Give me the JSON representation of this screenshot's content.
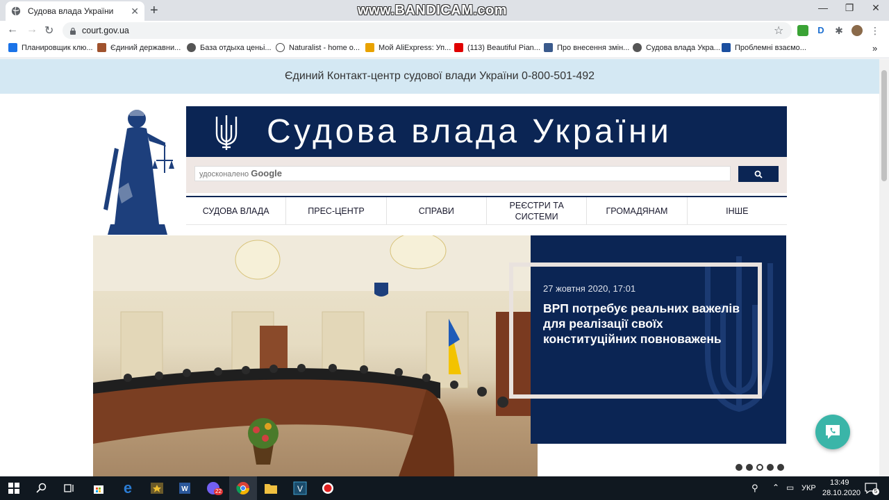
{
  "browser": {
    "tab_title": "Судова влада України",
    "new_tab": "+",
    "close_tab": "✕",
    "url": "court.gov.ua",
    "watermark": "www.BANDICAM.com",
    "window_controls": [
      "—",
      "❐",
      "✕"
    ],
    "bookmarks": [
      {
        "label": "Планировщик клю...",
        "color": "#1a73e8"
      },
      {
        "label": "Єдиний державни...",
        "color": "#a0522d"
      },
      {
        "label": "База отдыха ценьі...",
        "color": "#555555"
      },
      {
        "label": "Naturalist - home o...",
        "color": "#444444"
      },
      {
        "label": "Мой AliExpress: Уп...",
        "color": "#e8a200"
      },
      {
        "label": "(113) Beautiful Pian...",
        "color": "#e00000"
      },
      {
        "label": "Про внесення змін...",
        "color": "#3a5a8c"
      },
      {
        "label": "Судова влада Укра...",
        "color": "#555555"
      },
      {
        "label": "Проблемні взаємо...",
        "color": "#1b4fa0"
      }
    ],
    "more_bookmarks": "»"
  },
  "page": {
    "contact_line": "Єдиний Контакт-центр судової влади України 0-800-501-492",
    "site_title": "Судова влада України",
    "search": {
      "prefix": "удосконалено",
      "brand": "Google"
    },
    "nav": [
      "СУДОВА ВЛАДА",
      "ПРЕС-ЦЕНТР",
      "СПРАВИ",
      "РЕЄСТРИ ТА СИСТЕМИ",
      "ГРОМАДЯНАМ",
      "ІНШЕ"
    ],
    "hero": {
      "date": "27 жовтня 2020, 17:01",
      "headline": "ВРП потребує реальних важелів для реалізації своїх конституційних повноважень"
    },
    "slider": {
      "total": 5,
      "active": 3
    }
  },
  "taskbar": {
    "language": "УКР",
    "time": "13:49",
    "date": "28.10.2020",
    "viber_badge": "22",
    "notifications": "5"
  },
  "colors": {
    "navy": "#0b2554",
    "contact_bg": "#d4e8f3",
    "search_bg": "#efe7e4",
    "chat": "#3ab5a8"
  }
}
